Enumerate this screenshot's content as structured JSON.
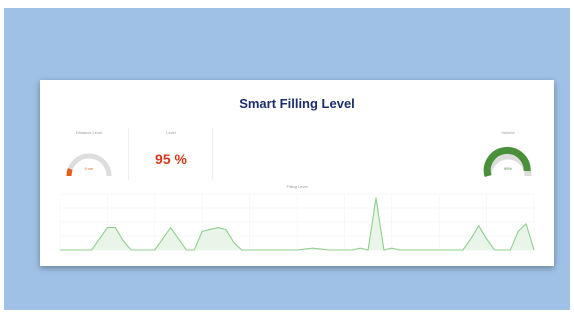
{
  "dashboard": {
    "title": "Smart Filling Level",
    "panels": {
      "gauge_left": {
        "label": "Distance Level",
        "value": "0 cm",
        "fraction": 0.05
      },
      "percent": {
        "label": "Level",
        "value": "95 %"
      },
      "gauge_right": {
        "label": "Volume",
        "value": "95%",
        "fraction": 0.95
      }
    },
    "colors": {
      "gauge_left_fill": "#e45b1b",
      "gauge_right_fill": "#4a8f39",
      "gauge_track": "#dddddd",
      "percent_text": "#d43a1a",
      "chart_line": "#8fcf8f",
      "chart_fill": "#e8f5e8"
    }
  },
  "chart_data": {
    "type": "area",
    "title": "Filling Level",
    "x": [
      0,
      1,
      2,
      3,
      4,
      5,
      6,
      7,
      8,
      9,
      10,
      11,
      12,
      13,
      14,
      15,
      16,
      17,
      18,
      19,
      20,
      21,
      22,
      23,
      24,
      25,
      26,
      27,
      28,
      29,
      30,
      31,
      32,
      33,
      34,
      35,
      36,
      37,
      38,
      39,
      40,
      41,
      42,
      43,
      44,
      45,
      46,
      47,
      48,
      49,
      50,
      51,
      52,
      53,
      54,
      55,
      56,
      57,
      58,
      59,
      60
    ],
    "values": [
      0,
      0,
      0,
      0,
      0,
      12,
      24,
      24,
      10,
      0,
      0,
      0,
      0,
      12,
      24,
      12,
      0,
      0,
      20,
      22,
      24,
      22,
      8,
      0,
      0,
      0,
      0,
      0,
      0,
      0,
      0,
      1,
      2,
      1,
      0,
      0,
      0,
      0,
      2,
      0,
      56,
      0,
      2,
      0,
      0,
      0,
      0,
      0,
      0,
      0,
      0,
      0,
      12,
      26,
      12,
      0,
      0,
      0,
      20,
      28,
      0
    ],
    "ylim": [
      0,
      60
    ],
    "grid": true
  }
}
